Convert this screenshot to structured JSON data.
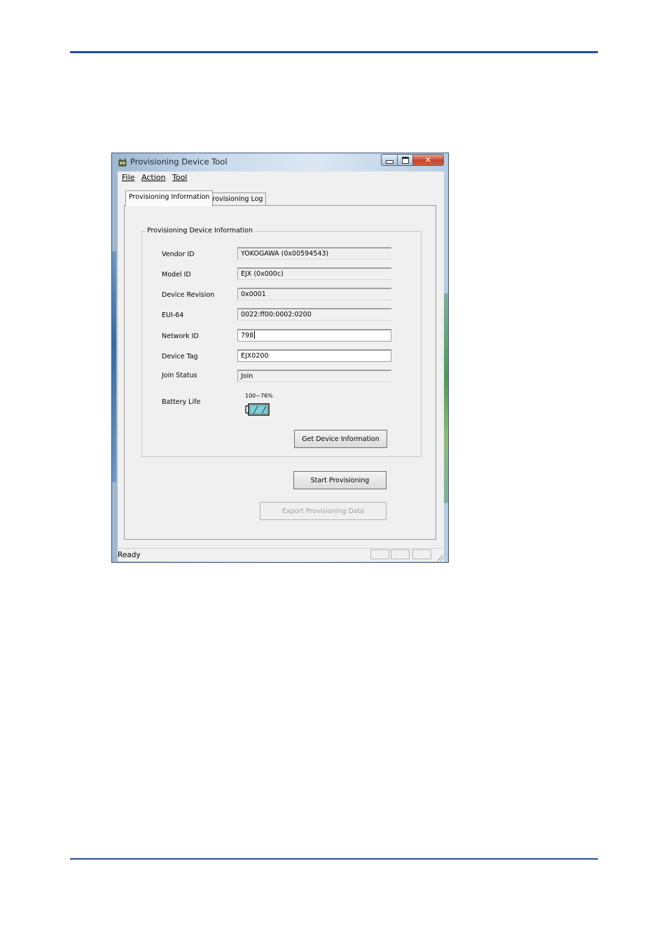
{
  "window": {
    "title": "Provisioning Device Tool",
    "caption_buttons": {
      "minimize": "minimize-icon",
      "maximize": "maximize-icon",
      "close": "✕"
    }
  },
  "menu": {
    "items": [
      "File",
      "Action",
      "Tool"
    ]
  },
  "tabs": [
    {
      "label": "Provisioning Information",
      "active": true
    },
    {
      "label": "Provisioning Log",
      "active": false
    }
  ],
  "group": {
    "legend": "Provisioning Device Information",
    "fields": [
      {
        "label": "Vendor ID",
        "value": "YOKOGAWA (0x00594543)",
        "editable": false
      },
      {
        "label": "Model ID",
        "value": "EJX (0x000c)",
        "editable": false
      },
      {
        "label": "Device Revision",
        "value": "0x0001",
        "editable": false
      },
      {
        "label": "EUI-64",
        "value": "0022:ff00:0002:0200",
        "editable": false
      },
      {
        "label": "Network ID",
        "value": "798",
        "editable": true
      },
      {
        "label": "Device Tag",
        "value": "EJX0200",
        "editable": true
      },
      {
        "label": "Join Status",
        "value": "Join",
        "editable": false
      }
    ],
    "battery": {
      "label": "Battery Life",
      "text": "100~76%",
      "level_fraction": 1.0,
      "color": "#7fd0d8"
    },
    "get_info_button": "Get Device Information"
  },
  "actions": {
    "start_button": "Start Provisioning",
    "export_button": "Export Provisioning Data",
    "export_enabled": false
  },
  "status": {
    "text": "Ready"
  },
  "colors": {
    "rule": "#1f4e9c",
    "close_button": "#c7462c"
  }
}
